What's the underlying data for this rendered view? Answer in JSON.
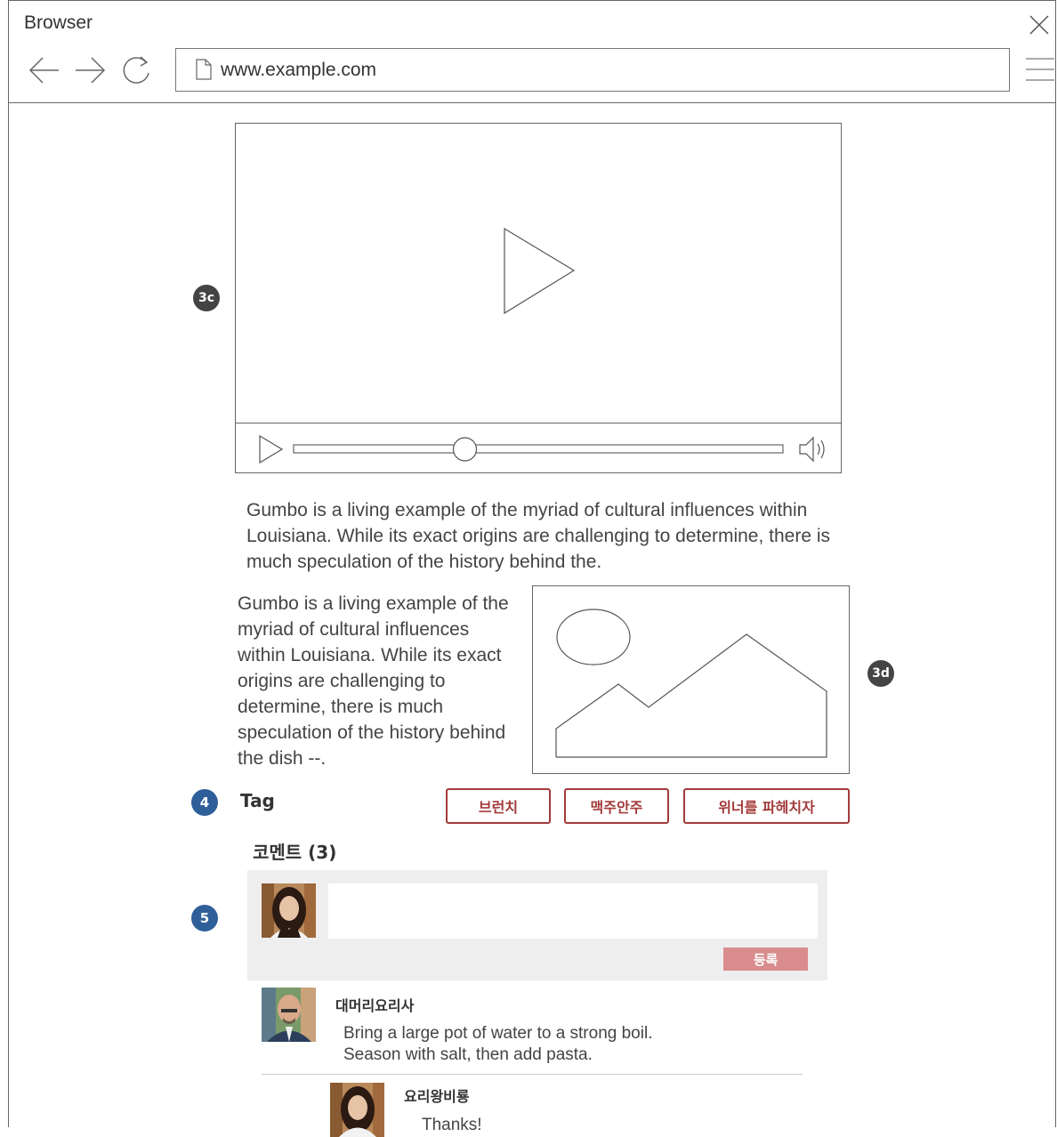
{
  "browser": {
    "title": "Browser",
    "url": "www.example.com"
  },
  "annotations": {
    "video": "3c",
    "image": "3d",
    "tags": "4",
    "comments": "5"
  },
  "video": {
    "progress": 0.35
  },
  "content": {
    "paragraph1": "Gumbo is a living example of the myriad of cultural influences within Louisiana. While its exact origins are challenging to determine, there is much speculation of the history behind the.",
    "paragraph2": "Gumbo is a living example of the myriad of cultural influences within Louisiana. While its exact origins are challenging to determine, there is much speculation of the history behind the dish --."
  },
  "tags": {
    "label": "Tag",
    "items": [
      "브런치",
      "맥주안주",
      "위너를 파헤치자"
    ]
  },
  "comments": {
    "title": "코멘트 (3)",
    "input_value": "",
    "submit_label": "등록",
    "items": [
      {
        "author": "대머리요리사",
        "text_line1": "Bring a large pot of water to a strong boil.",
        "text_line2": "Season with salt, then add pasta."
      },
      {
        "author": "요리왕비룡",
        "text_line1": "Thanks!"
      }
    ]
  },
  "colors": {
    "tag_accent": "#a33a3a",
    "submit_bg": "#d98c8c",
    "badge_dark": "#444444",
    "badge_blue": "#2f5f99"
  }
}
